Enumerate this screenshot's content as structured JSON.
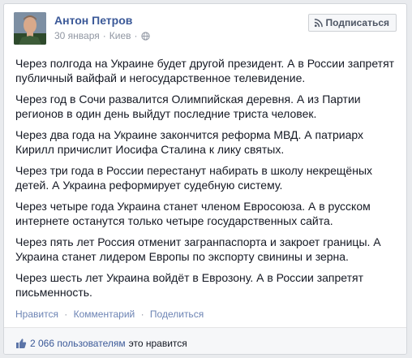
{
  "post": {
    "author": "Антон Петров",
    "date": "30 января",
    "location": "Киев",
    "follow_label": "Подписаться",
    "paragraphs": [
      "Через полгода на Украине будет другой президент. А в России запретят публичный вайфай и негосударственное телевидение.",
      "Через год в Сочи развалится Олимпийская деревня. А из Партии регионов в один день выйдут последние триста человек.",
      "Через два года на Украине закончится реформа МВД. А патриарх Кирилл причислит Иосифа Сталина к лику святых.",
      "Через три года в России перестанут набирать в школу некрещёных детей. А Украина реформирует судебную систему.",
      "Через четыре года Украина станет членом Евросоюза. А в русском интернете останутся только четыре государственных сайта.",
      "Через пять лет Россия отменит загранпаспорта и закроет границы. А Украина станет лидером Европы по экспорту свинины и зерна.",
      "Через шесть лет Украина войдёт в Еврозону. А в России запретят письменность."
    ]
  },
  "actions": {
    "like": "Нравится",
    "comment": "Комментарий",
    "share": "Поделиться",
    "separator": "·"
  },
  "likes": {
    "count_text": "2 066 пользователям",
    "suffix": "это нравится"
  },
  "icons": {
    "globe": "globe-icon",
    "rss": "rss-icon",
    "thumb": "thumbs-up-icon"
  },
  "colors": {
    "link": "#3b5998",
    "meta": "#9197a3",
    "text": "#141823"
  }
}
